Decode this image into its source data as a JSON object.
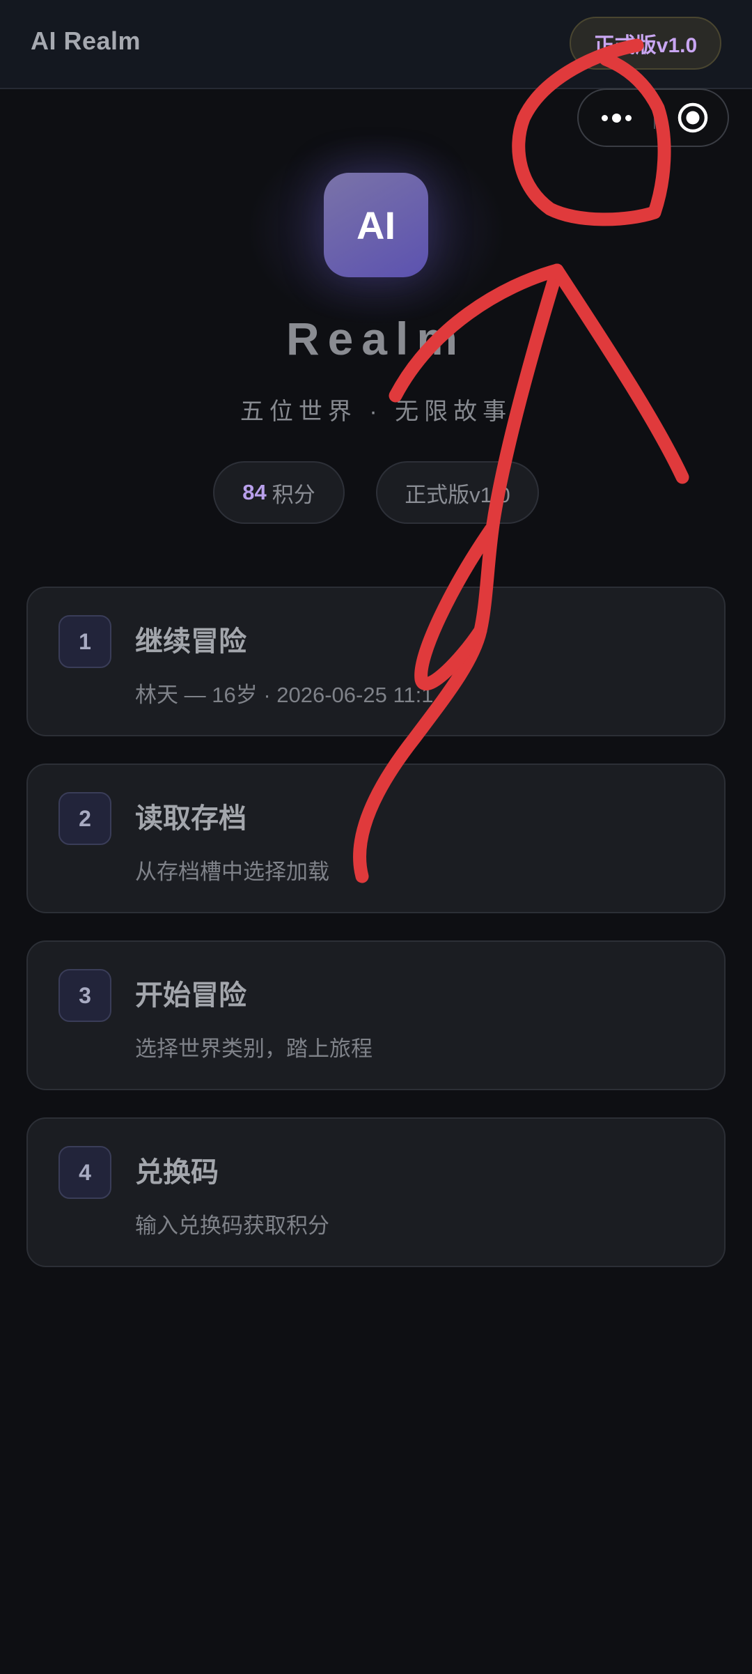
{
  "header": {
    "app_title": "AI Realm",
    "version_label": "正式版v1.0"
  },
  "capsule": {
    "more_icon": "more-dots-icon",
    "close_icon": "record-circle-icon"
  },
  "hero": {
    "logo_text": "AI",
    "title": "Realm",
    "tagline": "五位世界 · 无限故事",
    "points_value": "84",
    "points_label": "积分",
    "version_chip": "正式版v1.0"
  },
  "menu": [
    {
      "index": "1",
      "title": "继续冒险",
      "desc": "林天 — 16岁 · 2026-06-25 11:1"
    },
    {
      "index": "2",
      "title": "读取存档",
      "desc": "从存档槽中选择加载"
    },
    {
      "index": "3",
      "title": "开始冒险",
      "desc": "选择世界类别，踏上旅程"
    },
    {
      "index": "4",
      "title": "兑换码",
      "desc": "输入兑换码获取积分"
    }
  ],
  "colors": {
    "background": "#0e0f13",
    "accent_purple": "#b9a0ec",
    "annotation_red": "#e03a3c"
  }
}
